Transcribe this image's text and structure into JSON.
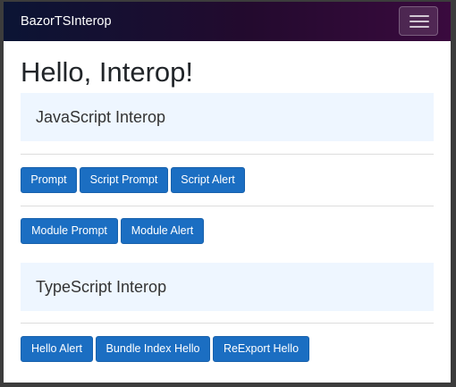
{
  "navbar": {
    "brand": "BazorTSInterop",
    "menu_icon": "hamburger-menu-icon"
  },
  "page": {
    "title": "Hello, Interop!"
  },
  "js_section": {
    "heading": "JavaScript Interop",
    "row1": [
      "Prompt",
      "Script Prompt",
      "Script Alert"
    ],
    "row2": [
      "Module Prompt",
      "Module Alert"
    ]
  },
  "ts_section": {
    "heading": "TypeScript Interop",
    "row1": [
      "Hello Alert",
      "Bundle Index Hello",
      "ReExport Hello"
    ]
  },
  "colors": {
    "button": "#1b6ec2",
    "section_bg": "#eef6ff",
    "navbar_start": "#0b1434",
    "navbar_end": "#3a0a3e"
  }
}
